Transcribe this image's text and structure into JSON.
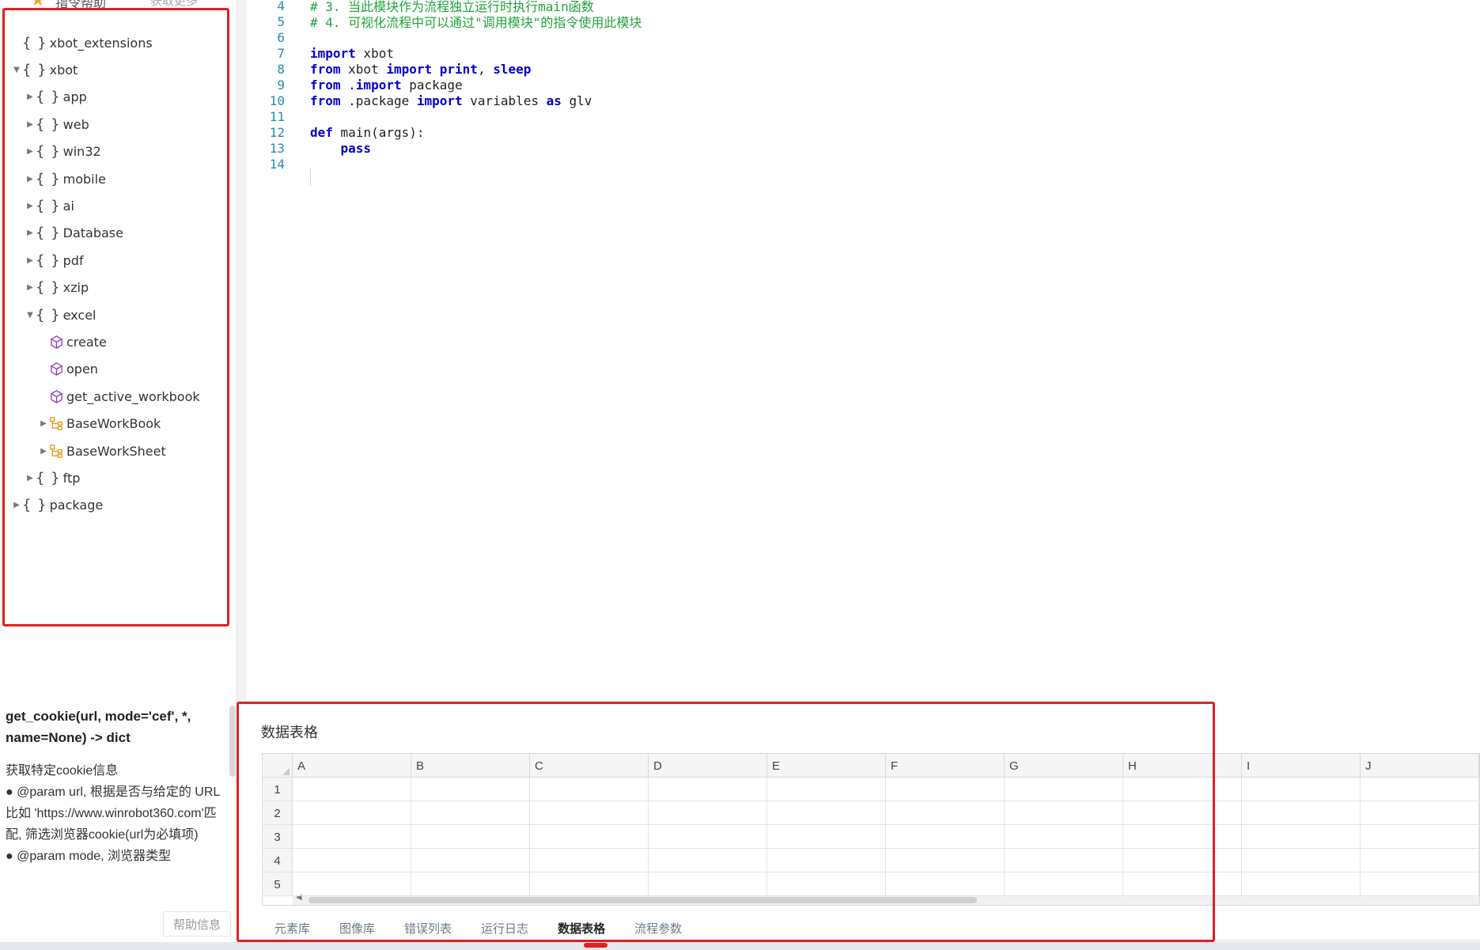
{
  "left_top": {
    "label": "指令帮助",
    "right_label": "获取更多"
  },
  "tree": [
    {
      "label": "xbot_extensions",
      "icon": "braces-icon",
      "indent": 0,
      "caret": "none"
    },
    {
      "label": "xbot",
      "icon": "braces-icon",
      "indent": 0,
      "caret": "expanded"
    },
    {
      "label": "app",
      "icon": "braces-icon",
      "indent": 1,
      "caret": "collapsed"
    },
    {
      "label": "web",
      "icon": "braces-icon",
      "indent": 1,
      "caret": "collapsed"
    },
    {
      "label": "win32",
      "icon": "braces-icon",
      "indent": 1,
      "caret": "collapsed"
    },
    {
      "label": "mobile",
      "icon": "braces-icon",
      "indent": 1,
      "caret": "collapsed"
    },
    {
      "label": "ai",
      "icon": "braces-icon",
      "indent": 1,
      "caret": "collapsed"
    },
    {
      "label": "Database",
      "icon": "braces-icon",
      "indent": 1,
      "caret": "collapsed"
    },
    {
      "label": "pdf",
      "icon": "braces-icon",
      "indent": 1,
      "caret": "collapsed"
    },
    {
      "label": "xzip",
      "icon": "braces-icon",
      "indent": 1,
      "caret": "collapsed"
    },
    {
      "label": "excel",
      "icon": "braces-icon",
      "indent": 1,
      "caret": "expanded"
    },
    {
      "label": "create",
      "icon": "cube-icon",
      "indent": 2,
      "caret": "none"
    },
    {
      "label": "open",
      "icon": "cube-icon",
      "indent": 2,
      "caret": "none"
    },
    {
      "label": "get_active_workbook",
      "icon": "cube-icon",
      "indent": 2,
      "caret": "none"
    },
    {
      "label": "BaseWorkBook",
      "icon": "class-icon",
      "indent": 2,
      "caret": "collapsed"
    },
    {
      "label": "BaseWorkSheet",
      "icon": "class-icon",
      "indent": 2,
      "caret": "collapsed"
    },
    {
      "label": "ftp",
      "icon": "braces-icon",
      "indent": 1,
      "caret": "collapsed"
    },
    {
      "label": "package",
      "icon": "braces-icon",
      "indent": 0,
      "caret": "collapsed"
    }
  ],
  "doc": {
    "signature": "get_cookie(url, mode='cef', *, name=None) -> dict",
    "lines": [
      "获取特定cookie信息",
      "● @param url, 根据是否与给定的 URL 比如 'https://www.winrobot360.com'匹配, 筛选浏览器cookie(url为必填项)",
      "● @param mode, 浏览器类型"
    ],
    "help_button": "帮助信息"
  },
  "code_lines": [
    {
      "n": "4",
      "tokens": [
        {
          "t": "# 3. 当此模块作为流程独立运行时执行main函数",
          "c": "cmt"
        }
      ]
    },
    {
      "n": "5",
      "tokens": [
        {
          "t": "# 4. 可视化流程中可以通过\"调用模块\"的指令使用此模块",
          "c": "cmt"
        }
      ]
    },
    {
      "n": "6",
      "tokens": []
    },
    {
      "n": "7",
      "tokens": [
        {
          "t": "import",
          "c": "kw"
        },
        {
          "t": " xbot",
          "c": ""
        }
      ]
    },
    {
      "n": "8",
      "tokens": [
        {
          "t": "from",
          "c": "kw"
        },
        {
          "t": " xbot ",
          "c": ""
        },
        {
          "t": "import",
          "c": "kw"
        },
        {
          "t": " ",
          "c": ""
        },
        {
          "t": "print",
          "c": "kw"
        },
        {
          "t": ", ",
          "c": ""
        },
        {
          "t": "sleep",
          "c": "kw"
        }
      ]
    },
    {
      "n": "9",
      "tokens": [
        {
          "t": "from",
          "c": "kw"
        },
        {
          "t": " .",
          "c": ""
        },
        {
          "t": "import",
          "c": "kw"
        },
        {
          "t": " package",
          "c": ""
        }
      ]
    },
    {
      "n": "10",
      "tokens": [
        {
          "t": "from",
          "c": "kw"
        },
        {
          "t": " .package ",
          "c": ""
        },
        {
          "t": "import",
          "c": "kw"
        },
        {
          "t": " variables ",
          "c": ""
        },
        {
          "t": "as",
          "c": "kw"
        },
        {
          "t": " glv",
          "c": ""
        }
      ]
    },
    {
      "n": "11",
      "tokens": []
    },
    {
      "n": "12",
      "tokens": [
        {
          "t": "def",
          "c": "kw"
        },
        {
          "t": " main(args):",
          "c": ""
        }
      ]
    },
    {
      "n": "13",
      "tokens": [
        {
          "t": "    ",
          "c": ""
        },
        {
          "t": "pass",
          "c": "kw"
        }
      ]
    },
    {
      "n": "14",
      "tokens": []
    }
  ],
  "grid": {
    "title": "数据表格",
    "columns": [
      "A",
      "B",
      "C",
      "D",
      "E",
      "F",
      "G",
      "H",
      "I",
      "J"
    ],
    "rows": [
      "1",
      "2",
      "3",
      "4",
      "5"
    ]
  },
  "tabs": [
    {
      "label": "元素库",
      "active": false
    },
    {
      "label": "图像库",
      "active": false
    },
    {
      "label": "错误列表",
      "active": false
    },
    {
      "label": "运行日志",
      "active": false
    },
    {
      "label": "数据表格",
      "active": true
    },
    {
      "label": "流程参数",
      "active": false
    }
  ],
  "colors": {
    "highlight": "#e02020",
    "comment": "#22a33a",
    "keyword": "#0000cc",
    "line_number": "#2b8ab0"
  }
}
